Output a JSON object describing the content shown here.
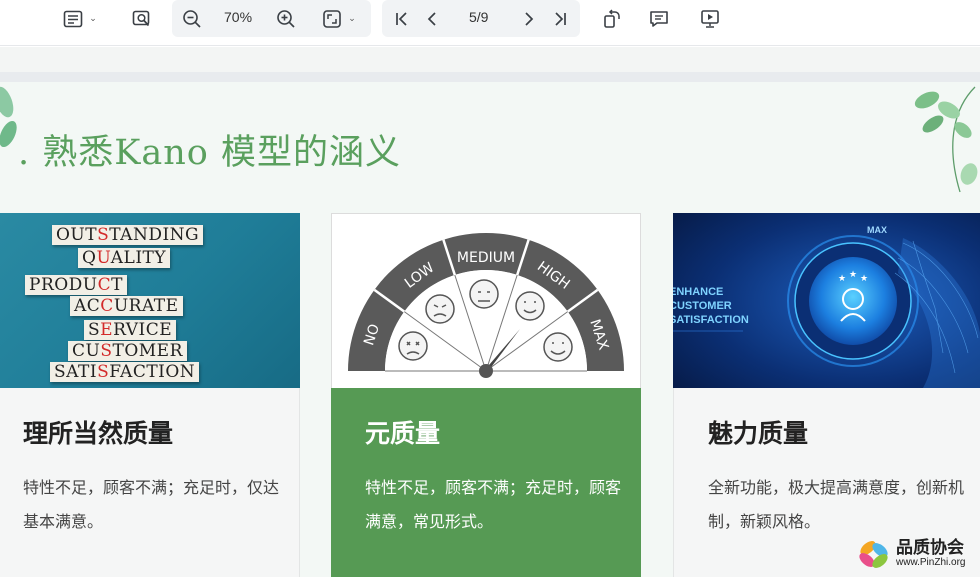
{
  "toolbar": {
    "icons": [
      "thumbnail-icon",
      "search-doc-icon",
      "zoom-out-icon",
      "zoom-in-icon",
      "fit-page-icon",
      "first-page-icon",
      "prev-page-icon",
      "next-page-icon",
      "last-page-icon",
      "rotate-icon",
      "comment-icon",
      "present-icon"
    ],
    "zoom": "70%",
    "page": "5/9"
  },
  "slide": {
    "title": ". 熟悉Kano 模型的涵义",
    "cards": [
      {
        "title": "理所当然质量",
        "text": "特性不足，顾客不满；充足时，仅达基本满意。",
        "image_words": [
          "OUTSTANDING",
          "QUALITY",
          "PRODUCT",
          "ACCURATE",
          "SERVICE",
          "CUSTOMER",
          "SATISFACTION"
        ]
      },
      {
        "title": "元质量",
        "text": "特性不足，顾客不满；充足时，顾客满意，常见形式。",
        "gauge_labels": [
          "NO",
          "LOW",
          "MEDIUM",
          "HIGH",
          "MAX"
        ]
      },
      {
        "title": "魅力质量",
        "text": "全新功能，极大提高满意度，创新机制，新颖风格。",
        "image_text": [
          "ENHANCE",
          "CUSTOMER",
          "SATISFACTION"
        ],
        "knob_label": "MAX"
      }
    ]
  },
  "watermark": {
    "name": "品质协会",
    "url": "www.PinZhi.org"
  },
  "colors": {
    "title_green": "#5aa05e",
    "card_green": "#569a54"
  }
}
